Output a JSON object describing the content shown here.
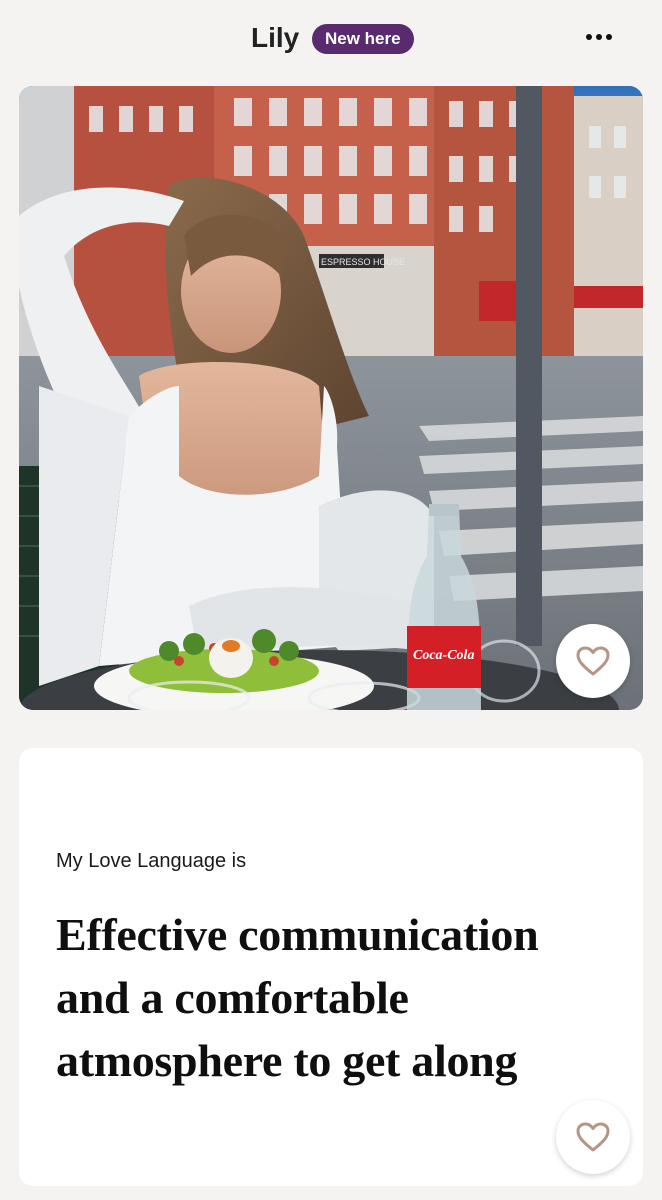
{
  "profile": {
    "name": "Lily",
    "badge": "New here",
    "more_icon": "more-horizontal-icon"
  },
  "photo": {
    "description_icon": "profile-photo",
    "bottle_label": "Coca-Cola",
    "sign_text": "ESPRESSO HOUSE"
  },
  "prompt": {
    "question": "My Love Language is",
    "answer": "Effective communication and a comfortable atmosphere to get along"
  },
  "actions": {
    "like_icon": "heart-icon"
  },
  "colors": {
    "badge": "#5a2a6e",
    "background": "#f4f3f2",
    "like_heart": "#b89486"
  }
}
